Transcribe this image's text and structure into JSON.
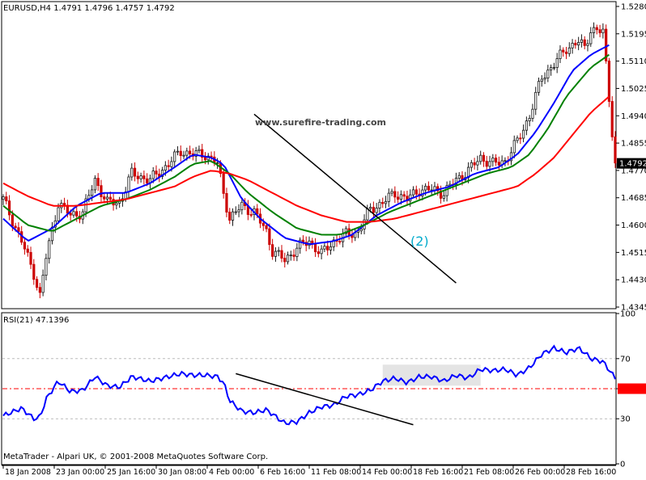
{
  "chart_data": [
    {
      "type": "line",
      "panel": "price",
      "symbol_line": "EURUSD,H4  1.4791 1.4796 1.4757 1.4792",
      "watermark": "www.surefire-trading.com",
      "annotation": "(2)",
      "current_price_label": "1.4792",
      "current_price": 1.4792,
      "ylim": [
        1.4345,
        1.529
      ],
      "y_ticks": [
        "1.5280",
        "1.5195",
        "1.5110",
        "1.5025",
        "1.4940",
        "1.4855",
        "1.4770",
        "1.4685",
        "1.4600",
        "1.4515",
        "1.4430",
        "1.4345"
      ],
      "x_ticks": [
        "18 Jan 2008",
        "23 Jan 00:00",
        "25 Jan 16:00",
        "30 Jan 08:00",
        "4 Feb 00:00",
        "6 Feb 16:00",
        "11 Feb 08:00",
        "14 Feb 00:00",
        "18 Feb 16:00",
        "21 Feb 08:00",
        "26 Feb 00:00",
        "28 Feb 16:00"
      ],
      "x_index_range": [
        0,
        100
      ],
      "close_anchors": [
        [
          0,
          1.468
        ],
        [
          3,
          1.455
        ],
        [
          5,
          1.445
        ],
        [
          6,
          1.438
        ],
        [
          7,
          1.45
        ],
        [
          9,
          1.467
        ],
        [
          11,
          1.463
        ],
        [
          13,
          1.464
        ],
        [
          15,
          1.474
        ],
        [
          17,
          1.467
        ],
        [
          19,
          1.467
        ],
        [
          21,
          1.476
        ],
        [
          24,
          1.474
        ],
        [
          27,
          1.479
        ],
        [
          29,
          1.483
        ],
        [
          31,
          1.482
        ],
        [
          33,
          1.482
        ],
        [
          35,
          1.479
        ],
        [
          36,
          1.47
        ],
        [
          37,
          1.462
        ],
        [
          39,
          1.466
        ],
        [
          41,
          1.464
        ],
        [
          43,
          1.458
        ],
        [
          44,
          1.452
        ],
        [
          46,
          1.449
        ],
        [
          48,
          1.453
        ],
        [
          50,
          1.455
        ],
        [
          52,
          1.451
        ],
        [
          54,
          1.455
        ],
        [
          56,
          1.457
        ],
        [
          58,
          1.458
        ],
        [
          60,
          1.465
        ],
        [
          62,
          1.467
        ],
        [
          64,
          1.47
        ],
        [
          66,
          1.468
        ],
        [
          68,
          1.471
        ],
        [
          70,
          1.471
        ],
        [
          72,
          1.47
        ],
        [
          74,
          1.474
        ],
        [
          76,
          1.477
        ],
        [
          78,
          1.481
        ],
        [
          80,
          1.479
        ],
        [
          82,
          1.48
        ],
        [
          84,
          1.486
        ],
        [
          86,
          1.494
        ],
        [
          88,
          1.506
        ],
        [
          90,
          1.51
        ],
        [
          92,
          1.515
        ],
        [
          94,
          1.517
        ],
        [
          95,
          1.515
        ],
        [
          96,
          1.521
        ],
        [
          98,
          1.52
        ],
        [
          100,
          1.479
        ]
      ],
      "moving_averages": [
        {
          "color": "#0000ff",
          "anchors": [
            [
              0,
              1.462
            ],
            [
              4,
              1.455
            ],
            [
              8,
              1.459
            ],
            [
              12,
              1.466
            ],
            [
              16,
              1.47
            ],
            [
              20,
              1.47
            ],
            [
              24,
              1.473
            ],
            [
              28,
              1.478
            ],
            [
              31,
              1.482
            ],
            [
              34,
              1.481
            ],
            [
              36,
              1.479
            ],
            [
              39,
              1.468
            ],
            [
              42,
              1.462
            ],
            [
              46,
              1.456
            ],
            [
              50,
              1.454
            ],
            [
              54,
              1.455
            ],
            [
              57,
              1.457
            ],
            [
              61,
              1.463
            ],
            [
              65,
              1.467
            ],
            [
              69,
              1.47
            ],
            [
              73,
              1.472
            ],
            [
              77,
              1.476
            ],
            [
              81,
              1.478
            ],
            [
              84,
              1.482
            ],
            [
              87,
              1.489
            ],
            [
              90,
              1.498
            ],
            [
              93,
              1.508
            ],
            [
              96,
              1.513
            ],
            [
              99,
              1.516
            ]
          ]
        },
        {
          "color": "#008000",
          "anchors": [
            [
              0,
              1.466
            ],
            [
              4,
              1.46
            ],
            [
              8,
              1.458
            ],
            [
              12,
              1.462
            ],
            [
              16,
              1.466
            ],
            [
              20,
              1.468
            ],
            [
              24,
              1.471
            ],
            [
              28,
              1.475
            ],
            [
              31,
              1.479
            ],
            [
              34,
              1.48
            ],
            [
              37,
              1.476
            ],
            [
              40,
              1.47
            ],
            [
              44,
              1.464
            ],
            [
              48,
              1.459
            ],
            [
              52,
              1.457
            ],
            [
              55,
              1.457
            ],
            [
              59,
              1.46
            ],
            [
              63,
              1.464
            ],
            [
              67,
              1.467
            ],
            [
              71,
              1.47
            ],
            [
              75,
              1.473
            ],
            [
              79,
              1.476
            ],
            [
              83,
              1.478
            ],
            [
              86,
              1.482
            ],
            [
              89,
              1.49
            ],
            [
              92,
              1.5
            ],
            [
              96,
              1.509
            ],
            [
              99,
              1.513
            ]
          ]
        },
        {
          "color": "#ff0000",
          "anchors": [
            [
              0,
              1.473
            ],
            [
              4,
              1.469
            ],
            [
              8,
              1.466
            ],
            [
              12,
              1.466
            ],
            [
              16,
              1.467
            ],
            [
              20,
              1.468
            ],
            [
              24,
              1.47
            ],
            [
              28,
              1.472
            ],
            [
              31,
              1.475
            ],
            [
              34,
              1.477
            ],
            [
              37,
              1.476
            ],
            [
              40,
              1.474
            ],
            [
              44,
              1.47
            ],
            [
              48,
              1.466
            ],
            [
              52,
              1.463
            ],
            [
              56,
              1.461
            ],
            [
              60,
              1.461
            ],
            [
              64,
              1.462
            ],
            [
              68,
              1.464
            ],
            [
              72,
              1.466
            ],
            [
              76,
              1.468
            ],
            [
              80,
              1.47
            ],
            [
              84,
              1.472
            ],
            [
              87,
              1.476
            ],
            [
              90,
              1.481
            ],
            [
              93,
              1.488
            ],
            [
              96,
              1.495
            ],
            [
              99,
              1.5
            ]
          ]
        }
      ],
      "trendline": {
        "from": [
          41,
          1.4945
        ],
        "to": [
          74,
          1.442
        ]
      }
    },
    {
      "type": "line",
      "panel": "rsi",
      "title": "RSI(21) 47.1396",
      "ylim": [
        0,
        100
      ],
      "y_ticks": [
        "100",
        "70",
        "50,0000",
        "30",
        "0"
      ],
      "levels": [
        70,
        50,
        30
      ],
      "series": [
        {
          "color": "#0000ff",
          "anchors": [
            [
              0,
              32
            ],
            [
              3,
              37
            ],
            [
              5,
              30
            ],
            [
              6,
              31
            ],
            [
              7,
              43
            ],
            [
              9,
              55
            ],
            [
              11,
              48
            ],
            [
              13,
              49
            ],
            [
              15,
              58
            ],
            [
              17,
              52
            ],
            [
              19,
              51
            ],
            [
              21,
              58
            ],
            [
              24,
              55
            ],
            [
              27,
              58
            ],
            [
              29,
              60
            ],
            [
              31,
              59
            ],
            [
              33,
              59
            ],
            [
              35,
              58
            ],
            [
              36,
              54
            ],
            [
              37,
              42
            ],
            [
              39,
              35
            ],
            [
              41,
              34
            ],
            [
              43,
              36
            ],
            [
              44,
              33
            ],
            [
              46,
              27
            ],
            [
              48,
              28
            ],
            [
              50,
              34
            ],
            [
              52,
              38
            ],
            [
              54,
              39
            ],
            [
              56,
              45
            ],
            [
              58,
              46
            ],
            [
              60,
              49
            ],
            [
              62,
              55
            ],
            [
              64,
              57
            ],
            [
              66,
              54
            ],
            [
              68,
              58
            ],
            [
              70,
              58
            ],
            [
              72,
              55
            ],
            [
              74,
              59
            ],
            [
              76,
              57
            ],
            [
              78,
              63
            ],
            [
              80,
              62
            ],
            [
              82,
              63
            ],
            [
              84,
              59
            ],
            [
              86,
              64
            ],
            [
              88,
              73
            ],
            [
              90,
              77
            ],
            [
              92,
              74
            ],
            [
              94,
              77
            ],
            [
              95,
              74
            ],
            [
              96,
              70
            ],
            [
              98,
              68
            ],
            [
              100,
              57
            ]
          ]
        }
      ],
      "trendline": {
        "from": [
          38,
          60
        ],
        "to": [
          67,
          26
        ]
      },
      "highlight_box": {
        "x_index": [
          62,
          78
        ],
        "y": [
          52,
          66
        ]
      }
    }
  ],
  "footer": {
    "copyright": "MetaTrader - Alpari UK, © 2001-2008 MetaQuotes Software Corp."
  }
}
